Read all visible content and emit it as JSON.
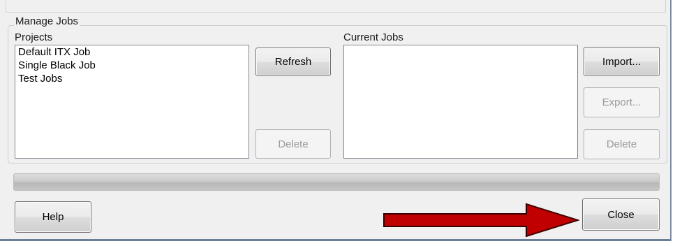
{
  "group": {
    "title": "Manage Jobs"
  },
  "projects": {
    "label": "Projects",
    "items": [
      "Default ITX Job",
      "Single Black Job",
      "Test Jobs"
    ],
    "refresh_label": "Refresh",
    "delete_label": "Delete"
  },
  "current_jobs": {
    "label": "Current Jobs",
    "items": [],
    "import_label": "Import...",
    "export_label": "Export...",
    "delete_label": "Delete"
  },
  "progress": {
    "value": 0
  },
  "footer": {
    "help_label": "Help",
    "close_label": "Close"
  },
  "colors": {
    "arrow_fill": "#c00000",
    "arrow_stroke": "#3a0000"
  },
  "annotation": {
    "icon": "red-arrow-icon",
    "points_to": "close-button"
  }
}
